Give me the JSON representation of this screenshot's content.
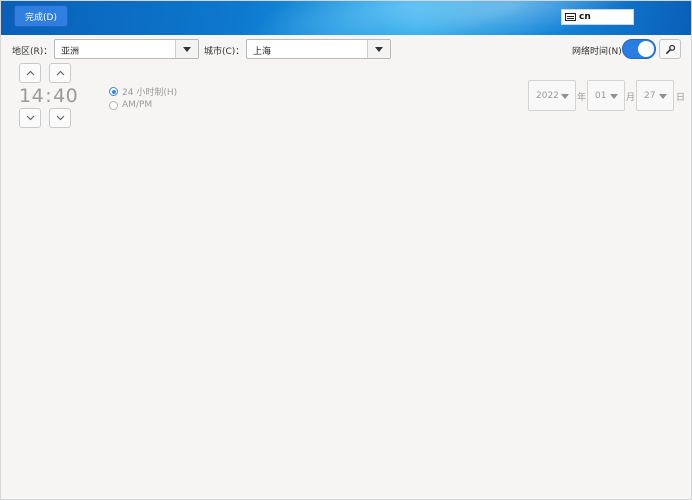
{
  "header": {
    "done_label": "完成(D)",
    "ime_label": "cn"
  },
  "region": {
    "label": "地区(R)：",
    "value": "亚洲"
  },
  "city": {
    "label": "城市(C)：",
    "value": "上海"
  },
  "network_time": {
    "label": "网络时间(N)",
    "enabled": true
  },
  "time": {
    "hour": "14",
    "separator": ":",
    "minute": "40"
  },
  "format": {
    "option_24": "24 小时制(H)",
    "option_ampm": "AM/PM",
    "selected": "24"
  },
  "date": {
    "year": "2022",
    "year_unit": "年",
    "month": "01",
    "month_unit": "月",
    "day": "27",
    "day_unit": "日"
  },
  "colors": {
    "accent": "#2b7de1",
    "header_blue": "#0d79cf"
  },
  "icons": [
    "keyboard-icon",
    "chevron-down-icon",
    "chevron-up-icon",
    "wrench-icon"
  ]
}
